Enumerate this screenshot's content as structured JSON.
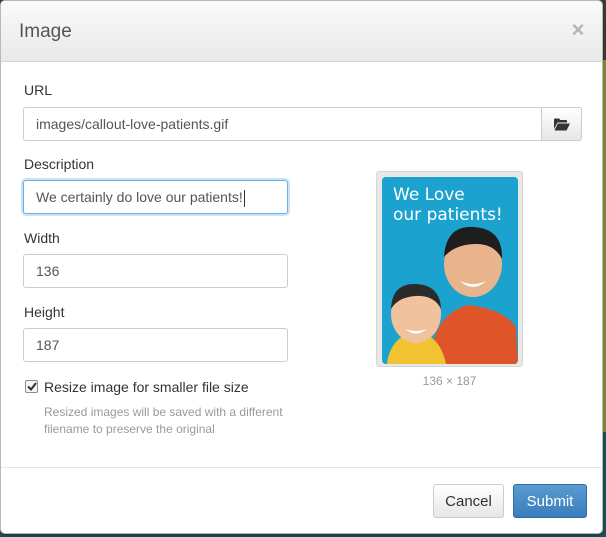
{
  "dialog": {
    "title": "Image",
    "close_glyph": "×"
  },
  "form": {
    "url": {
      "label": "URL",
      "value": "images/callout-love-patients.gif"
    },
    "browse_icon": "folder-open-icon",
    "description": {
      "label": "Description",
      "value": "We certainly do love our patients!"
    },
    "width": {
      "label": "Width",
      "value": "136"
    },
    "height": {
      "label": "Height",
      "value": "187"
    },
    "resize": {
      "checked": true,
      "label": "Resize image for smaller file size",
      "help": "Resized images will be saved with a different filename to preserve the original"
    }
  },
  "preview": {
    "image_text_line1": "We Love",
    "image_text_line2": "our patients!",
    "dimensions": "136 × 187"
  },
  "footer": {
    "cancel_label": "Cancel",
    "submit_label": "Submit"
  },
  "colors": {
    "primary": "#3a7dbd",
    "focus": "#66afe9",
    "image_background": "#1ba2cf"
  }
}
